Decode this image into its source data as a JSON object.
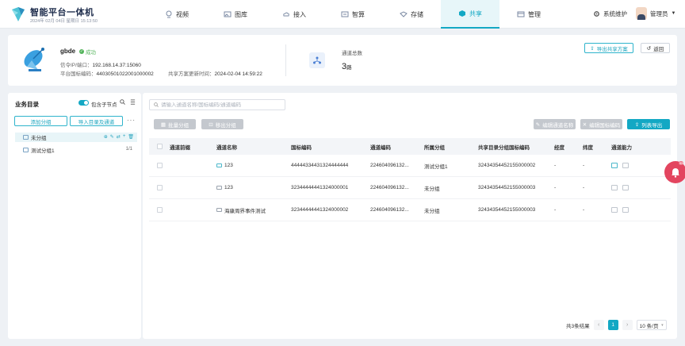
{
  "app": {
    "title": "智能平台一体机",
    "datetime": "2024年 02月 04日 星期日 15:13:50"
  },
  "nav": [
    {
      "label": "视频",
      "icon": "camera-icon"
    },
    {
      "label": "图库",
      "icon": "gallery-icon"
    },
    {
      "label": "接入",
      "icon": "cloud-icon"
    },
    {
      "label": "智算",
      "icon": "compute-icon"
    },
    {
      "label": "存储",
      "icon": "storage-icon"
    },
    {
      "label": "共享",
      "icon": "share-icon",
      "active": true
    },
    {
      "label": "管理",
      "icon": "manage-icon"
    }
  ],
  "header_right": {
    "system_label": "系统维护",
    "user_label": "管理员"
  },
  "device": {
    "name": "gbde",
    "status": "成功",
    "signal_label": "信令IP/端口：",
    "signal_value": "192.168.14.37:15060",
    "gb_code_label": "平台国标编码：",
    "gb_code_value": "44030501022001000002",
    "share_time_label": "共享方案更新时间：",
    "share_time_value": "2024-02-04 14:59:22"
  },
  "channel_summary": {
    "label": "通道总数",
    "count": "3",
    "unit": "路"
  },
  "actions": {
    "export_plan": "导出共享方案",
    "back": "返回"
  },
  "left_panel": {
    "title": "业务目录",
    "include_children": "包含子节点",
    "add_group": "添加分组",
    "import_dir": "导入目录及通道",
    "more": "···",
    "tree": [
      {
        "label": "未分组",
        "selected": true
      },
      {
        "label": "测试分组1",
        "count": "1/1"
      }
    ]
  },
  "toolbar": {
    "search_placeholder": "请输入通道名称/国标编码/通道编码",
    "batch_group": "批量分组",
    "remove_group": "移出分组",
    "edit_channel_name": "编辑通道名称",
    "edit_gb_code": "编辑国标编码",
    "export_list": "列表导出"
  },
  "table": {
    "headers": [
      "通道前缀",
      "通道名称",
      "国标编码",
      "通道编码",
      "所属分组",
      "共享目录分组国标编码",
      "经度",
      "纬度",
      "通道能力"
    ],
    "rows": [
      {
        "prefix": "",
        "name": "123",
        "gb_code": "44444334431324444444",
        "ch_code": "224604096132...",
        "group": "测试分组1",
        "dir_code": "32434354452155000002",
        "lng": "-",
        "lat": "-",
        "cam_active": true
      },
      {
        "prefix": "",
        "name": "123",
        "gb_code": "32344444441324000001",
        "ch_code": "224604096132...",
        "group": "未分组",
        "dir_code": "32434354452155000003",
        "lng": "-",
        "lat": "-",
        "cam_active": false
      },
      {
        "prefix": "",
        "name": "海康周界事件测试",
        "gb_code": "32344444441324000002",
        "ch_code": "224604096132...",
        "group": "未分组",
        "dir_code": "32434354452155000003",
        "lng": "-",
        "lat": "-",
        "cam_active": false
      }
    ]
  },
  "pagination": {
    "total": "共3条结果",
    "current": "1",
    "page_size": "10 条/页"
  },
  "notification": {
    "badge": "99"
  },
  "colors": {
    "accent": "#13a8c4",
    "success": "#52b35a",
    "alert": "#e3455f"
  }
}
